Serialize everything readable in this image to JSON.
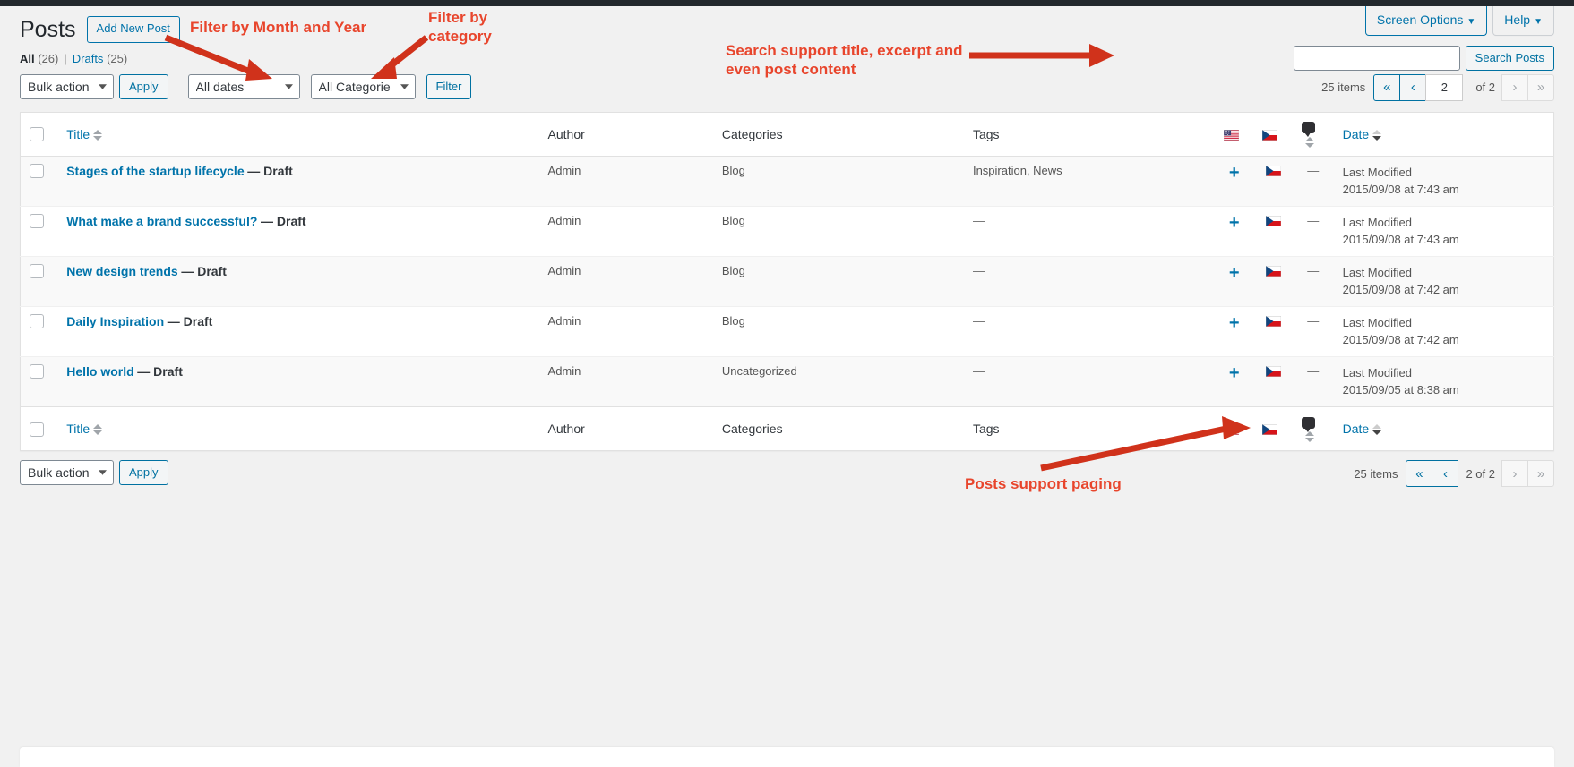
{
  "screen_meta": {
    "screen_options_label": "Screen Options",
    "help_label": "Help",
    "caret": "▼"
  },
  "header": {
    "title": "Posts",
    "add_new_label": "Add New Post"
  },
  "views": {
    "all_label": "All",
    "all_count": "(26)",
    "separator": "|",
    "drafts_label": "Drafts",
    "drafts_count": "(25)"
  },
  "search": {
    "value": "",
    "placeholder": "",
    "submit_label": "Search Posts"
  },
  "tablenav_top": {
    "bulk_actions_label": "Bulk actions",
    "apply_label": "Apply",
    "dates_filter_label": "All dates",
    "categories_filter_label": "All Categories",
    "filter_label": "Filter",
    "displaying_num": "25 items",
    "first_page": "«",
    "prev_page": "‹",
    "current_page": "2",
    "total_pages_label": "of 2",
    "next_page": "›",
    "last_page": "»"
  },
  "tablenav_bottom": {
    "bulk_actions_label": "Bulk actions",
    "apply_label": "Apply",
    "displaying_num": "25 items",
    "first_page": "«",
    "prev_page": "‹",
    "paging_text": "2 of 2",
    "next_page": "›",
    "last_page": "»"
  },
  "table": {
    "columns": {
      "title": "Title",
      "author": "Author",
      "categories": "Categories",
      "tags": "Tags",
      "flag_en": "en-flag-icon",
      "flag_cs": "cs-flag-icon",
      "comments": "comment-bubble-icon",
      "date": "Date"
    },
    "rows": [
      {
        "title": "Stages of the startup lifecycle",
        "state": "— Draft",
        "author": "Admin",
        "categories": "Blog",
        "tags": "Inspiration, News",
        "tags_links": [
          "Inspiration",
          "News"
        ],
        "translate_icon": "plus-icon",
        "lang_flag": "cs-flag-icon",
        "comments": "—",
        "date_status": "Last Modified",
        "date_value": "2015/09/08 at 7:43 am"
      },
      {
        "title": "What make a brand successful?",
        "state": "— Draft",
        "author": "Admin",
        "categories": "Blog",
        "tags": "—",
        "tags_links": [],
        "translate_icon": "plus-icon",
        "lang_flag": "cs-flag-icon",
        "comments": "—",
        "date_status": "Last Modified",
        "date_value": "2015/09/08 at 7:43 am"
      },
      {
        "title": "New design trends",
        "state": "— Draft",
        "author": "Admin",
        "categories": "Blog",
        "tags": "—",
        "tags_links": [],
        "translate_icon": "plus-icon",
        "lang_flag": "cs-flag-icon",
        "comments": "—",
        "date_status": "Last Modified",
        "date_value": "2015/09/08 at 7:42 am"
      },
      {
        "title": "Daily Inspiration",
        "state": "— Draft",
        "author": "Admin",
        "categories": "Blog",
        "tags": "—",
        "tags_links": [],
        "translate_icon": "plus-icon",
        "lang_flag": "cs-flag-icon",
        "comments": "—",
        "date_status": "Last Modified",
        "date_value": "2015/09/08 at 7:42 am"
      },
      {
        "title": "Hello world",
        "state": "— Draft",
        "author": "Admin",
        "categories": "Uncategorized",
        "tags": "—",
        "tags_links": [],
        "translate_icon": "plus-icon",
        "lang_flag": "cs-flag-icon",
        "comments": "—",
        "date_status": "Last Modified",
        "date_value": "2015/09/05 at 8:38 am"
      }
    ]
  },
  "annotations": {
    "month_year": "Filter by Month and Year",
    "category": "Filter by\ncategory",
    "search": "Search support title, excerpt and\neven post content",
    "paging": "Posts support paging",
    "color": "#e8452c"
  }
}
